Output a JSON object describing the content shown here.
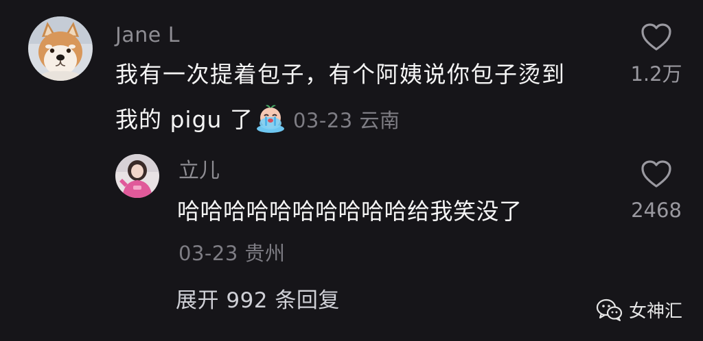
{
  "comment": {
    "author": "Jane L",
    "avatar": "shiba-dog-avatar",
    "text_line1": "我有一次提着包子，有个阿姨说你包子烫到",
    "text_line2": "我的 pigu 了",
    "emoji": "crying-emoji",
    "meta": "03-23 云南",
    "like_count": "1.2万",
    "like_icon": "heart-outline-icon"
  },
  "reply": {
    "author": "立儿",
    "avatar": "girl-pink-hoodie-avatar",
    "text": "哈哈哈哈哈哈哈哈哈哈给我笑没了",
    "meta": "03-23 贵州",
    "like_count": "2468",
    "like_icon": "heart-outline-icon"
  },
  "expand_label": "展开 992 条回复",
  "watermark": {
    "icon": "wechat-icon",
    "text": "女神汇"
  },
  "colors": {
    "background": "#161519",
    "primary_text": "#f5f5f5",
    "secondary_text": "#8e8d93"
  }
}
